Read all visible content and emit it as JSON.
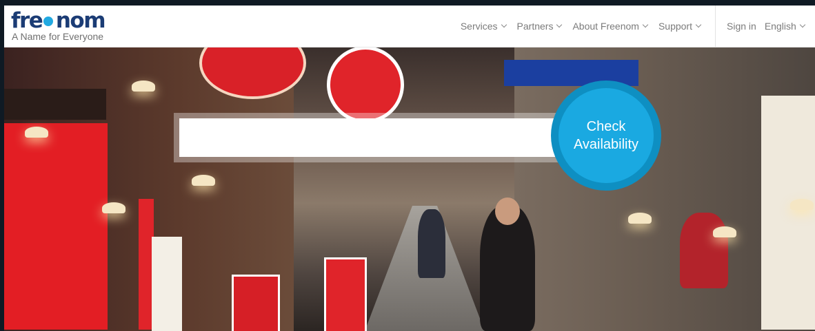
{
  "header": {
    "logo_text": "freenom",
    "tagline": "A Name for Everyone",
    "nav": [
      {
        "label": "Services"
      },
      {
        "label": "Partners"
      },
      {
        "label": "About Freenom"
      },
      {
        "label": "Support"
      }
    ],
    "sign_in": "Sign in",
    "language": "English"
  },
  "hero": {
    "search_value": "",
    "cta_line1": "Check",
    "cta_line2": "Availability"
  },
  "colors": {
    "brand_dark": "#1b3c75",
    "brand_blue": "#1aa9e1",
    "cta_ring": "#0e8fc2"
  }
}
